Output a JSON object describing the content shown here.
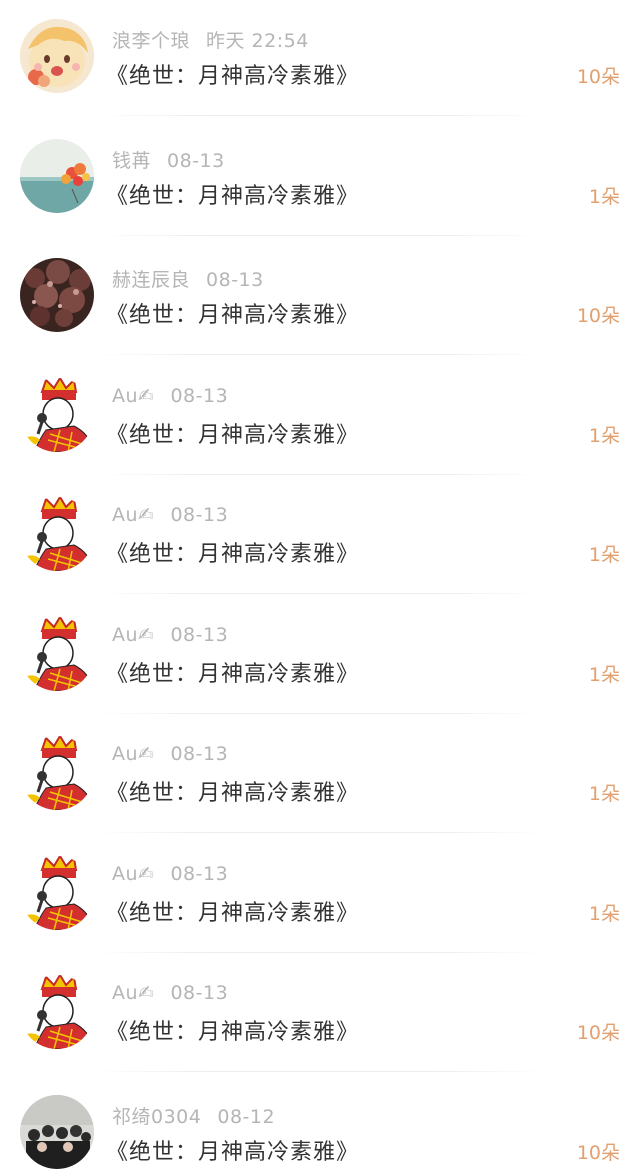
{
  "items": [
    {
      "user": "浪李个琅",
      "time": "昨天 22:54",
      "title": "《绝世：月神高冷素雅》",
      "amount": "10朵",
      "avatar": "anime-girl-avatar"
    },
    {
      "user": "钱苒",
      "time": "08-13",
      "title": "《绝世：月神高冷素雅》",
      "amount": "1朵",
      "avatar": "sea-balloons-avatar"
    },
    {
      "user": "赫连辰良",
      "time": "08-13",
      "title": "《绝世：月神高冷素雅》",
      "amount": "10朵",
      "avatar": "cherry-blossom-avatar"
    },
    {
      "user": "Au✍",
      "time": "08-13",
      "title": "《绝世：月神高冷素雅》",
      "amount": "1朵",
      "avatar": "singing-cartoon-avatar"
    },
    {
      "user": "Au✍",
      "time": "08-13",
      "title": "《绝世：月神高冷素雅》",
      "amount": "1朵",
      "avatar": "singing-cartoon-avatar"
    },
    {
      "user": "Au✍",
      "time": "08-13",
      "title": "《绝世：月神高冷素雅》",
      "amount": "1朵",
      "avatar": "singing-cartoon-avatar"
    },
    {
      "user": "Au✍",
      "time": "08-13",
      "title": "《绝世：月神高冷素雅》",
      "amount": "1朵",
      "avatar": "singing-cartoon-avatar"
    },
    {
      "user": "Au✍",
      "time": "08-13",
      "title": "《绝世：月神高冷素雅》",
      "amount": "1朵",
      "avatar": "singing-cartoon-avatar"
    },
    {
      "user": "Au✍",
      "time": "08-13",
      "title": "《绝世：月神高冷素雅》",
      "amount": "10朵",
      "avatar": "singing-cartoon-avatar"
    },
    {
      "user": "祁绮0304",
      "time": "08-12",
      "title": "《绝世：月神高冷素雅》",
      "amount": "10朵",
      "avatar": "group-photo-avatar"
    }
  ],
  "colors": {
    "meta": "#b5b5b5",
    "title": "#333333",
    "amount": "#e1a070",
    "divider": "#ececec"
  }
}
